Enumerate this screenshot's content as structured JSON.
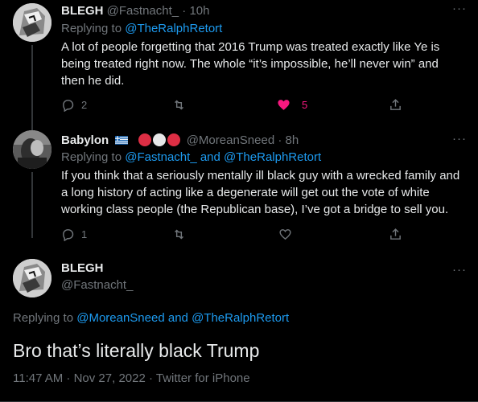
{
  "tweet1": {
    "name": "BLEGH",
    "handle": "@Fastnacht_",
    "time": "· 10h",
    "replying_prefix": "Replying to ",
    "replying_to": "@TheRalphRetort",
    "text": "A lot of people forgetting that 2016 Trump was treated exactly like Ye is being treated right now. The whole “it’s impossible, he’ll never win” and then he did.",
    "replies": "2",
    "likes": "5",
    "liked": true
  },
  "tweet2": {
    "name": "Babylon",
    "handle": "@MoreanSneed",
    "time": "· 8h",
    "replying_prefix": "Replying to ",
    "replying_to_1": "@Fastnacht_",
    "and": " and ",
    "replying_to_2": "@TheRalphRetort",
    "text": "If you think that a seriously mentally ill black guy with a wrecked family and a long history of acting like a degenerate will get out the vote of white working class people (the Republican base), I’ve got a bridge to sell you.",
    "replies": "1"
  },
  "main_tweet": {
    "name": "BLEGH",
    "handle": "@Fastnacht_",
    "replying_prefix": "Replying to ",
    "replying_to_1": "@MoreanSneed",
    "and": " and ",
    "replying_to_2": "@TheRalphRetort",
    "text": "Bro that’s literally black Trump",
    "timestamp": "11:47 AM · Nov 27, 2022 · Twitter for iPhone"
  },
  "icons": {
    "reply": "reply-icon",
    "retweet": "retweet-icon",
    "like": "heart-icon",
    "share": "share-icon",
    "more": "more-icon"
  },
  "colors": {
    "background": "#000000",
    "text": "#e7e9ea",
    "secondary": "#71767b",
    "accent": "#1d9bf0",
    "like": "#f91880"
  },
  "more_glyph": "···"
}
